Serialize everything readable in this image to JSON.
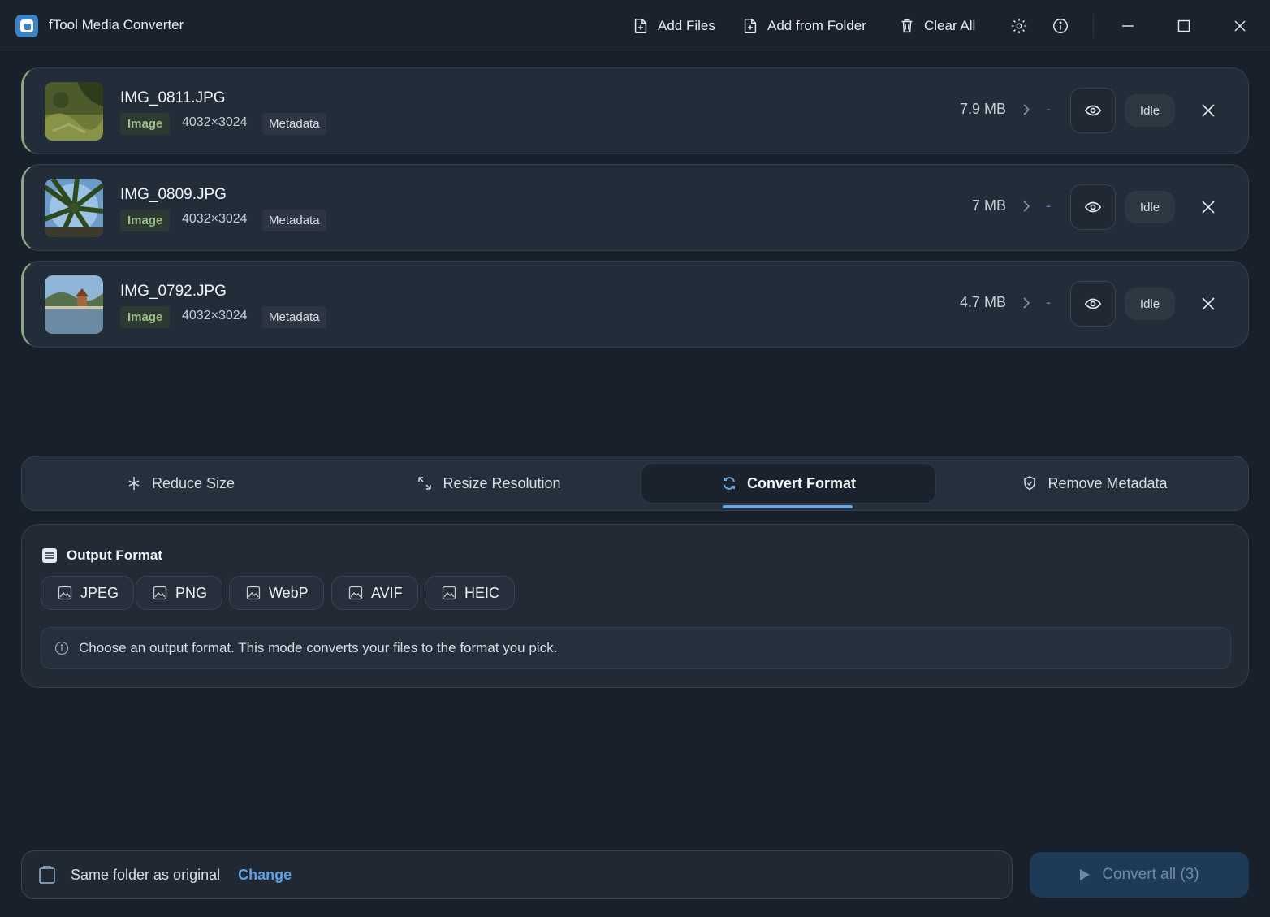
{
  "app": {
    "title": "fTool Media Converter"
  },
  "toolbar": {
    "add_files": "Add Files",
    "add_folder": "Add from Folder",
    "clear_all": "Clear All"
  },
  "files": [
    {
      "name": "IMG_0811.JPG",
      "type": "Image",
      "dims": "4032×3024",
      "meta": "Metadata",
      "size": "7.9 MB",
      "result": "-",
      "status": "Idle"
    },
    {
      "name": "IMG_0809.JPG",
      "type": "Image",
      "dims": "4032×3024",
      "meta": "Metadata",
      "size": "7 MB",
      "result": "-",
      "status": "Idle"
    },
    {
      "name": "IMG_0792.JPG",
      "type": "Image",
      "dims": "4032×3024",
      "meta": "Metadata",
      "size": "4.7 MB",
      "result": "-",
      "status": "Idle"
    }
  ],
  "tabs": [
    {
      "label": "Reduce Size",
      "icon": "sparkle-icon"
    },
    {
      "label": "Resize Resolution",
      "icon": "expand-icon"
    },
    {
      "label": "Convert Format",
      "icon": "refresh-icon",
      "active": true
    },
    {
      "label": "Remove Metadata",
      "icon": "shield-icon"
    }
  ],
  "output": {
    "title": "Output Format",
    "formats": [
      "JPEG",
      "PNG",
      "WebP",
      "AVIF",
      "HEIC"
    ],
    "info": "Choose an output format. This mode converts your files to the format you pick."
  },
  "footer": {
    "folder_label": "Same folder as original",
    "change_label": "Change",
    "convert_label": "Convert all (3)"
  },
  "colors": {
    "accent": "#6aa7e3",
    "image_badge": "#9bbf86",
    "background": "#18202b"
  }
}
